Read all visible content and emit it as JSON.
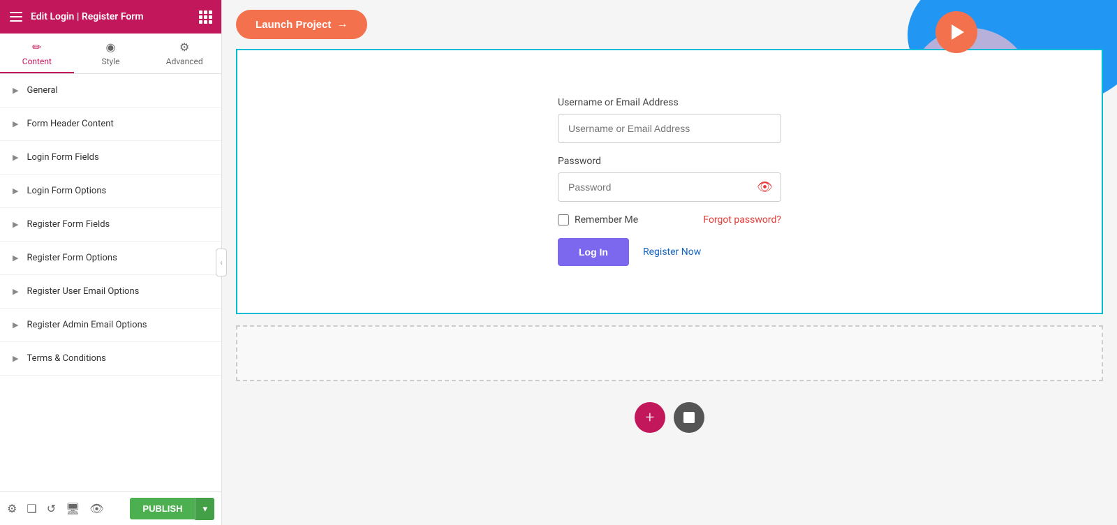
{
  "header": {
    "title": "Edit Login | Register Form",
    "hamburger_icon": "hamburger-icon",
    "grid_icon": "grid-icon"
  },
  "tabs": [
    {
      "id": "content",
      "label": "Content",
      "icon": "✏️",
      "active": true
    },
    {
      "id": "style",
      "label": "Style",
      "icon": "🎨",
      "active": false
    },
    {
      "id": "advanced",
      "label": "Advanced",
      "icon": "⚙️",
      "active": false
    }
  ],
  "sections": [
    {
      "id": "general",
      "label": "General"
    },
    {
      "id": "form-header-content",
      "label": "Form Header Content"
    },
    {
      "id": "login-form-fields",
      "label": "Login Form Fields"
    },
    {
      "id": "login-form-options",
      "label": "Login Form Options"
    },
    {
      "id": "register-form-fields",
      "label": "Register Form Fields"
    },
    {
      "id": "register-form-options",
      "label": "Register Form Options"
    },
    {
      "id": "register-user-email-options",
      "label": "Register User Email Options"
    },
    {
      "id": "register-admin-email-options",
      "label": "Register Admin Email Options"
    },
    {
      "id": "terms-and-conditions",
      "label": "Terms & Conditions"
    }
  ],
  "bottom_bar": {
    "publish_label": "PUBLISH",
    "icons": [
      "settings",
      "layers",
      "history",
      "desktop",
      "eye"
    ]
  },
  "main": {
    "launch_button": "Launch Project",
    "form": {
      "username_label": "Username or Email Address",
      "username_placeholder": "Username or Email Address",
      "password_label": "Password",
      "password_placeholder": "Password",
      "remember_me_label": "Remember Me",
      "forgot_password_label": "Forgot password?",
      "login_button": "Log In",
      "register_link": "Register Now"
    }
  }
}
